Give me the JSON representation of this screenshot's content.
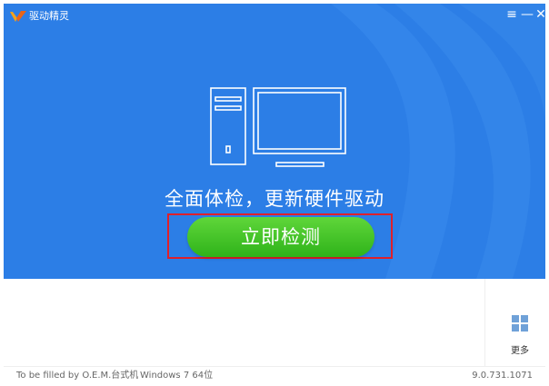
{
  "titlebar": {
    "app_title": "驱动精灵",
    "logo_icon": "driver-genius-logo",
    "menu_icon": "menu-icon",
    "minimize_icon": "minimize-icon",
    "close_icon": "close-icon",
    "menu_glyph": "≡",
    "minimize_glyph": "—",
    "close_glyph": "✕"
  },
  "main": {
    "illustration": "desktop-computer-icon",
    "slogan": "全面体检，更新硬件驱动",
    "scan_button_label": "立即检测"
  },
  "side": {
    "more_icon": "grid-icon",
    "more_label": "更多"
  },
  "statusbar": {
    "machine_text": "To be filled by O.E.M.台式机",
    "os_text": "Windows 7 64位",
    "version_text": "9.0.731.1071"
  },
  "colors": {
    "hero_background": "#2c7ee6",
    "button_green": "#3cc222",
    "highlight_red": "#e0202a"
  }
}
